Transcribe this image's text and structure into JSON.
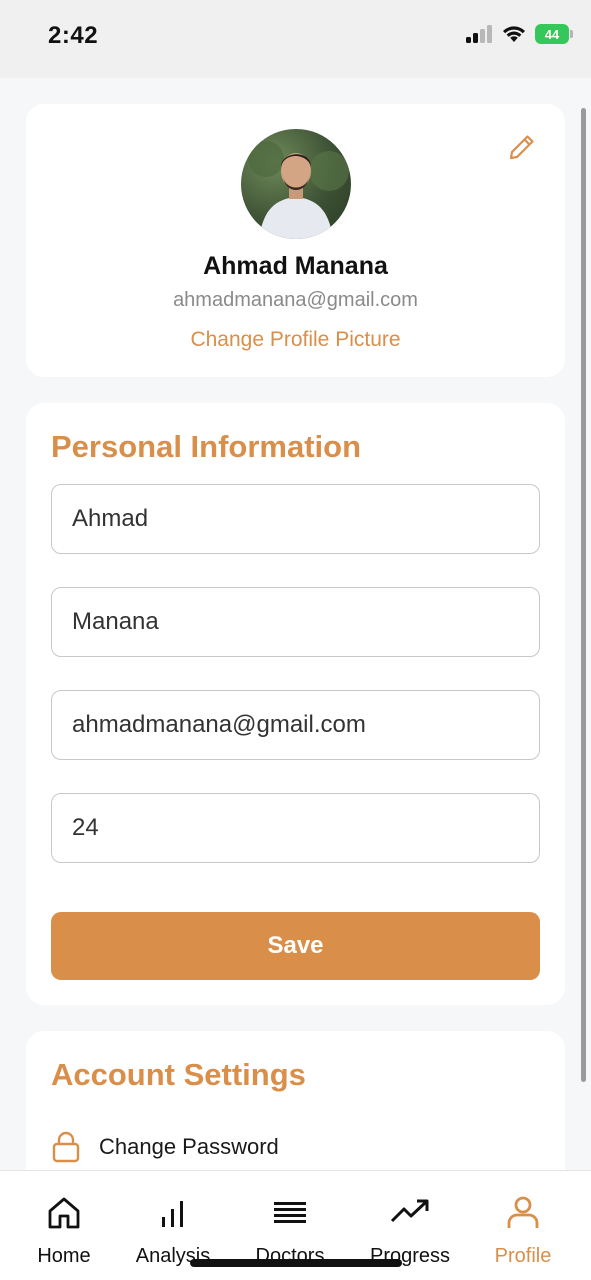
{
  "status_bar": {
    "time": "2:42",
    "battery": "44"
  },
  "profile": {
    "name": "Ahmad Manana",
    "email": "ahmadmanana@gmail.com",
    "change_picture_label": "Change Profile Picture"
  },
  "personal_info": {
    "title": "Personal Information",
    "first_name": "Ahmad",
    "last_name": "Manana",
    "email": "ahmadmanana@gmail.com",
    "age": "24",
    "save_label": "Save"
  },
  "account_settings": {
    "title": "Account Settings",
    "items": [
      {
        "label": "Change Password",
        "icon": "lock-icon"
      }
    ]
  },
  "tab_bar": {
    "tabs": [
      {
        "label": "Home",
        "icon": "home-icon"
      },
      {
        "label": "Analysis",
        "icon": "bar-chart-icon"
      },
      {
        "label": "Doctors",
        "icon": "list-icon"
      },
      {
        "label": "Progress",
        "icon": "trending-up-icon"
      },
      {
        "label": "Profile",
        "icon": "person-icon"
      }
    ],
    "active": "Profile"
  },
  "colors": {
    "accent": "#d98f4a",
    "battery": "#35c759"
  }
}
